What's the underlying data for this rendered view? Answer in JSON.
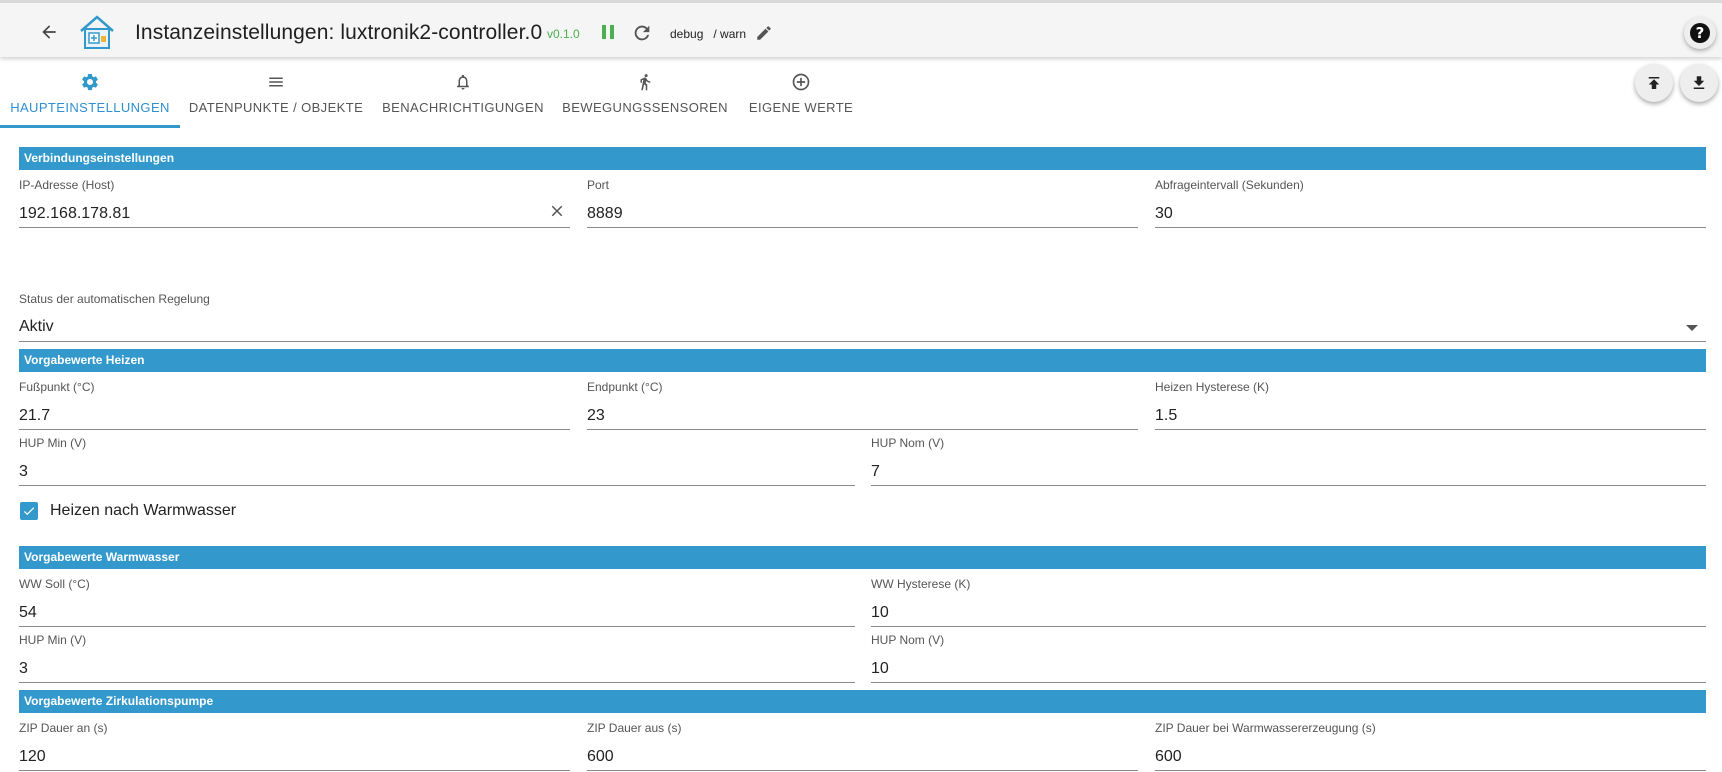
{
  "header": {
    "title": "Instanzeinstellungen: luxtronik2-controller.0",
    "version": "v0.1.0",
    "loglevel_primary": "debug",
    "loglevel_secondary": "/ warn",
    "help_label": "?"
  },
  "icons": {
    "back": "arrow-left-icon",
    "logo": "app-logo-icon",
    "pause": "pause-icon",
    "reload": "reload-icon",
    "edit": "pencil-icon",
    "help": "help-icon",
    "upload": "upload-icon",
    "download": "download-icon"
  },
  "colors": {
    "accent": "#3399cc",
    "version_green": "#4caf50",
    "tab_active": "#2f8fd0"
  },
  "tabs": [
    {
      "label": "HAUPTEINSTELLUNGEN",
      "icon": "gear-icon",
      "active": true
    },
    {
      "label": "DATENPUNKTE / OBJEKTE",
      "icon": "list-icon",
      "active": false
    },
    {
      "label": "BENACHRICHTIGUNGEN",
      "icon": "bell-icon",
      "active": false
    },
    {
      "label": "BEWEGUNGSSENSOREN",
      "icon": "walking-icon",
      "active": false
    },
    {
      "label": "EIGENE WERTE",
      "icon": "plus-circle-icon",
      "active": false
    }
  ],
  "sections": {
    "connection": "Verbindungseinstellungen",
    "heating": "Vorgabewerte Heizen",
    "hotwater": "Vorgabewerte Warmwasser",
    "circulation": "Vorgabewerte Zirkulationspumpe"
  },
  "connection": {
    "ip_label": "IP-Adresse (Host)",
    "ip_value": "192.168.178.81",
    "port_label": "Port",
    "port_value": "8889",
    "interval_label": "Abfrageintervall (Sekunden)",
    "interval_value": "30"
  },
  "automatic": {
    "label": "Status der automatischen Regelung",
    "value": "Aktiv"
  },
  "heating": {
    "fusspunkt_label": "Fußpunkt (°C)",
    "fusspunkt_value": "21.7",
    "endpunkt_label": "Endpunkt (°C)",
    "endpunkt_value": "23",
    "hysterese_label": "Heizen Hysterese (K)",
    "hysterese_value": "1.5",
    "hup_min_label": "HUP Min (V)",
    "hup_min_value": "3",
    "hup_nom_label": "HUP Nom (V)",
    "hup_nom_value": "7",
    "after_hotwater_label": "Heizen nach Warmwasser",
    "after_hotwater_checked": true
  },
  "hotwater": {
    "soll_label": "WW Soll (°C)",
    "soll_value": "54",
    "hysterese_label": "WW Hysterese (K)",
    "hysterese_value": "10",
    "hup_min_label": "HUP Min (V)",
    "hup_min_value": "3",
    "hup_nom_label": "HUP Nom (V)",
    "hup_nom_value": "10"
  },
  "circulation": {
    "on_label": "ZIP Dauer an (s)",
    "on_value": "120",
    "off_label": "ZIP Dauer aus (s)",
    "off_value": "600",
    "hw_label": "ZIP Dauer bei Warmwassererzeugung (s)",
    "hw_value": "600"
  }
}
